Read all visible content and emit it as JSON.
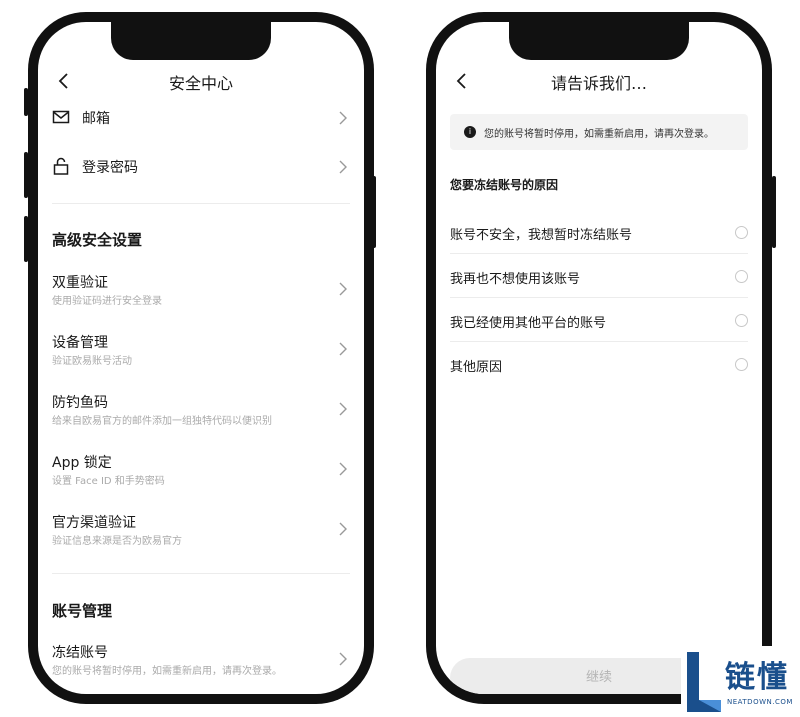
{
  "left_screen": {
    "nav": {
      "title": "安全中心"
    },
    "top_items": [
      {
        "label": "邮箱",
        "icon": "mail-icon"
      },
      {
        "label": "登录密码",
        "icon": "lock-icon"
      }
    ],
    "advanced_section": {
      "title": "高级安全设置",
      "items": [
        {
          "label": "双重验证",
          "sub": "使用验证码进行安全登录"
        },
        {
          "label": "设备管理",
          "sub": "验证欧易账号活动"
        },
        {
          "label": "防钓鱼码",
          "sub": "给来自欧易官方的邮件添加一组独特代码以便识别"
        },
        {
          "label": "App 锁定",
          "sub": "设置 Face ID 和手势密码"
        },
        {
          "label": "官方渠道验证",
          "sub": "验证信息来源是否为欧易官方"
        }
      ]
    },
    "account_section": {
      "title": "账号管理",
      "items": [
        {
          "label": "冻结账号",
          "sub": "您的账号将暂时停用，如需重新启用，请再次登录。"
        }
      ]
    }
  },
  "right_screen": {
    "nav": {
      "title": "请告诉我们…"
    },
    "notice": {
      "icon": "info-icon",
      "text": "您的账号将暂时停用，如需重新启用，请再次登录。"
    },
    "question": "您要冻结账号的原因",
    "options": [
      {
        "label": "账号不安全，我想暂时冻结账号"
      },
      {
        "label": "我再也不想使用该账号"
      },
      {
        "label": "我已经使用其他平台的账号"
      },
      {
        "label": "其他原因"
      }
    ],
    "continue_label": "继续"
  },
  "watermark": {
    "cn": "链懂",
    "en": "NEATDOWN.COM"
  },
  "colors": {
    "frame": "#111111",
    "divider": "#ececec",
    "subtext": "#aaaaaa",
    "watermark": "#1a4f8c"
  }
}
